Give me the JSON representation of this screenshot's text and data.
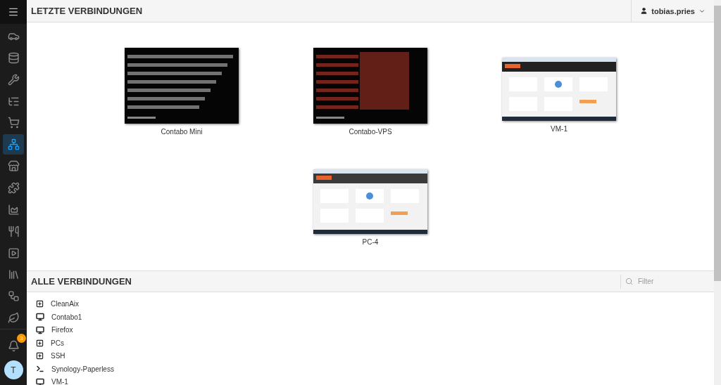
{
  "sidebar": {
    "items": [
      {
        "selected": false
      },
      {
        "selected": false
      },
      {
        "selected": false
      },
      {
        "selected": false
      },
      {
        "selected": false
      },
      {
        "selected": true
      },
      {
        "selected": false
      },
      {
        "selected": false
      },
      {
        "selected": false
      },
      {
        "selected": false
      },
      {
        "selected": false
      },
      {
        "selected": false
      },
      {
        "selected": false
      },
      {
        "selected": false
      }
    ],
    "notifications": "3",
    "avatar": "T"
  },
  "recent": {
    "title": "LETZTE VERBINDUNGEN",
    "user": "tobias.pries",
    "connections": [
      {
        "name": "Contabo Mini",
        "kind": "picture"
      },
      {
        "name": "Contabo-VPS",
        "kind": "picture"
      },
      {
        "name": "VM-1",
        "kind": "picture"
      },
      {
        "name": "PC-4",
        "kind": "picture"
      }
    ]
  },
  "all": {
    "title": "ALLE VERBINDUNGEN",
    "filter": {
      "placeholder": "Filter"
    },
    "items": [
      {
        "name": "CleanAix",
        "kind": "group"
      },
      {
        "name": "Contabo1",
        "kind": "desktop"
      },
      {
        "name": "Firefox",
        "kind": "desktop"
      },
      {
        "name": "PCs",
        "kind": "group"
      },
      {
        "name": "SSH",
        "kind": "group"
      },
      {
        "name": "Synology-Paperless",
        "kind": "ssh"
      },
      {
        "name": "VM-1",
        "kind": "desktop"
      }
    ]
  }
}
